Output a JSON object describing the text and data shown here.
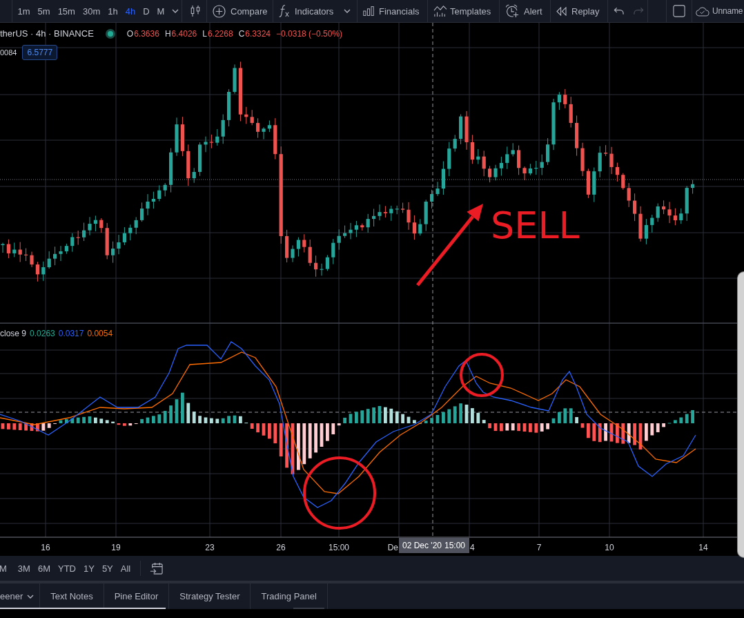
{
  "toolbar": {
    "intervals": [
      {
        "label": "1m",
        "selected": false
      },
      {
        "label": "5m",
        "selected": false
      },
      {
        "label": "15m",
        "selected": false
      },
      {
        "label": "30m",
        "selected": false
      },
      {
        "label": "1h",
        "selected": false
      },
      {
        "label": "4h",
        "selected": true
      },
      {
        "label": "D",
        "selected": false
      },
      {
        "label": "M",
        "selected": false
      }
    ],
    "tools": [
      {
        "kind": "compare",
        "label": "Compare",
        "has_menu": false
      },
      {
        "kind": "indicators",
        "label": "Indicators",
        "has_menu": true
      },
      {
        "kind": "financials",
        "label": "Financials",
        "has_menu": false
      },
      {
        "kind": "templates",
        "label": "Templates",
        "has_menu": false
      },
      {
        "kind": "alert",
        "label": "Alert",
        "has_menu": false
      },
      {
        "kind": "replay",
        "label": "Replay",
        "has_menu": false
      }
    ],
    "history": [
      {
        "kind": "undo",
        "disabled": false
      },
      {
        "kind": "redo",
        "disabled": true
      }
    ],
    "layout_name": "Unname"
  },
  "legend": {
    "symbol": "therUS · 4h · BINANCE",
    "ohlc": [
      {
        "label": "O",
        "value": "6.3636"
      },
      {
        "label": "H",
        "value": "6.4026"
      },
      {
        "label": "L",
        "value": "6.2268"
      },
      {
        "label": "C",
        "value": "6.3324"
      }
    ],
    "change": "−0.0318 (−0.50%)",
    "indicator_value": "0084",
    "price_badge": "6.5777"
  },
  "macd_legend": {
    "label": "close 9",
    "values": [
      {
        "text": "0.0263",
        "color": "#22ab94"
      },
      {
        "text": "0.0317",
        "color": "#2962ff"
      },
      {
        "text": "0.0054",
        "color": "#ff6d00"
      }
    ]
  },
  "annotations": [
    {
      "kind": "arrow"
    },
    {
      "kind": "text",
      "text": "SELL"
    },
    {
      "kind": "circle"
    },
    {
      "kind": "circle"
    }
  ],
  "x_axis": {
    "labels": [
      "16",
      "19",
      "23",
      "26",
      "15:00",
      "De",
      "4",
      "7",
      "10",
      "14"
    ],
    "crosshair_date": "02 Dec '20",
    "crosshair_time": "15:00"
  },
  "time_ranges": [
    "M",
    "3M",
    "6M",
    "YTD",
    "1Y",
    "5Y",
    "All"
  ],
  "bottom_tabs": [
    {
      "label": "eener",
      "dropdown": true
    },
    {
      "label": "Text Notes",
      "dropdown": false
    },
    {
      "label": "Pine Editor",
      "dropdown": false
    },
    {
      "label": "Strategy Tester",
      "dropdown": false
    },
    {
      "label": "Trading Panel",
      "dropdown": false
    }
  ]
}
